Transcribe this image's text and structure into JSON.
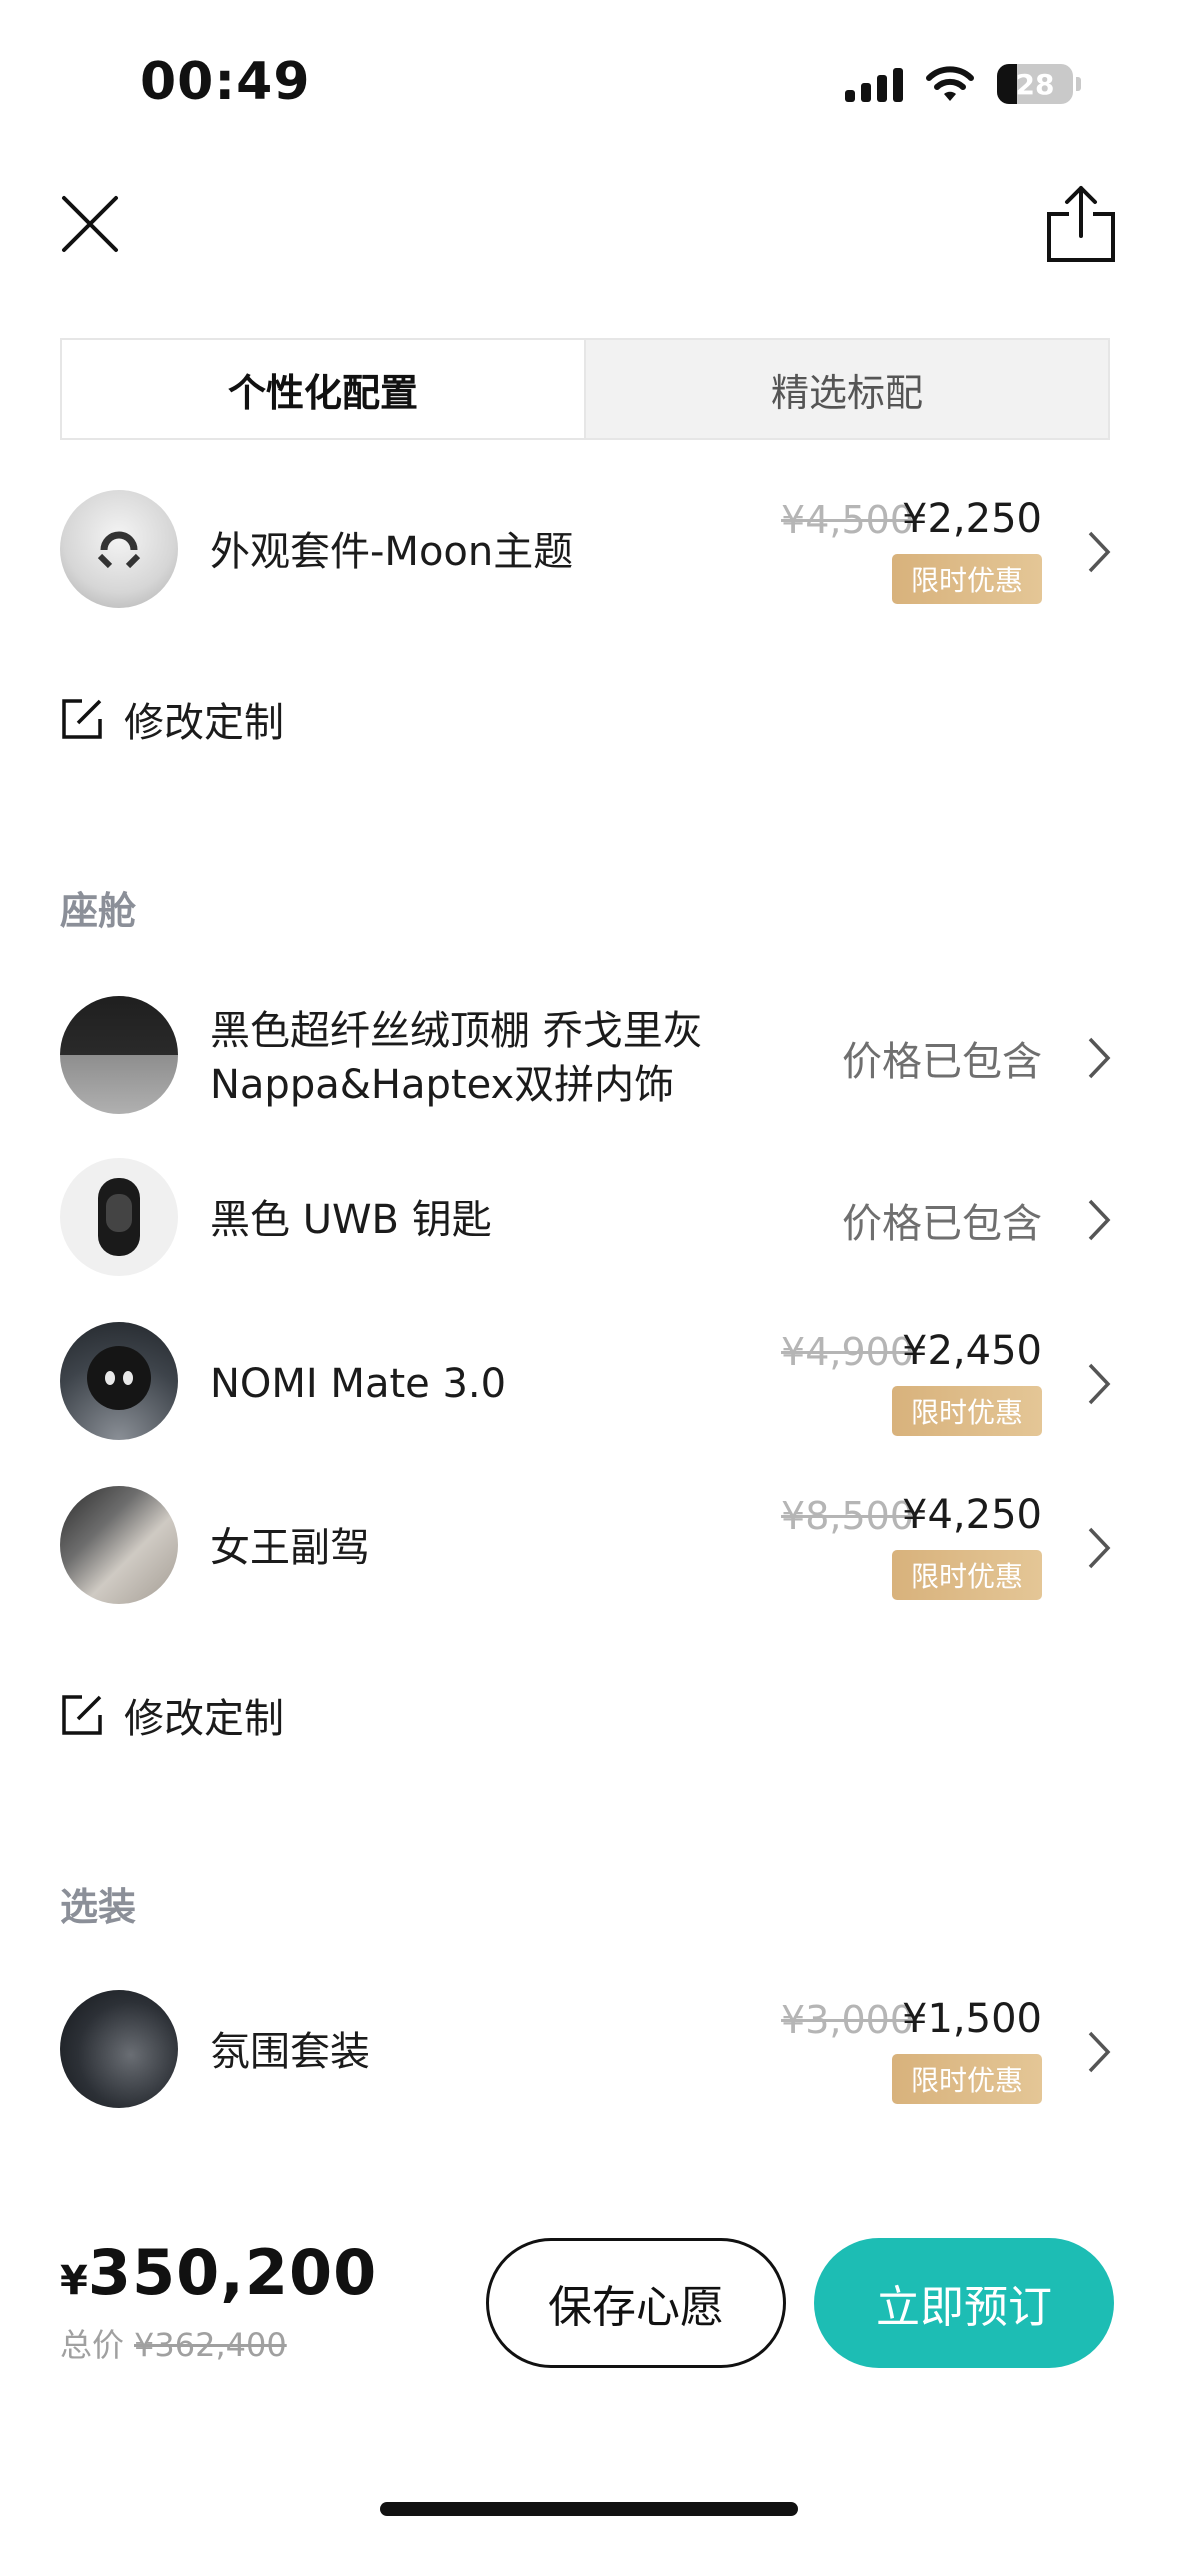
{
  "status_bar": {
    "time": "00:49",
    "battery": "28"
  },
  "tabs": [
    {
      "label": "个性化配置",
      "active": true
    },
    {
      "label": "精选标配",
      "active": false
    }
  ],
  "exterior": {
    "item": {
      "name": "外观套件-Moon主题",
      "price_original": "¥4,500",
      "price_current": "¥2,250",
      "badge": "限时优惠"
    },
    "edit_label": "修改定制"
  },
  "cabin": {
    "title": "座舱",
    "items": [
      {
        "name_line1": "黑色超纤丝绒顶棚 乔戈里灰",
        "name_line2": "Nappa&Haptex双拼内饰",
        "status": "价格已包含"
      },
      {
        "name": "黑色 UWB 钥匙",
        "status": "价格已包含"
      },
      {
        "name": "NOMI Mate 3.0",
        "price_original": "¥4,900",
        "price_current": "¥2,450",
        "badge": "限时优惠"
      },
      {
        "name": "女王副驾",
        "price_original": "¥8,500",
        "price_current": "¥4,250",
        "badge": "限时优惠"
      }
    ],
    "edit_label": "修改定制"
  },
  "options": {
    "title": "选装",
    "items": [
      {
        "name": "氛围套装",
        "price_original": "¥3,000",
        "price_current": "¥1,500",
        "badge": "限时优惠"
      }
    ]
  },
  "footer": {
    "currency": "¥",
    "total": "350,200",
    "total_label": "总价",
    "total_original": "¥362,400",
    "save_button": "保存心愿",
    "order_button": "立即预订"
  },
  "colors": {
    "accent": "#1dbdb4",
    "badge": "#d8b27c",
    "muted": "#8b8f98"
  }
}
